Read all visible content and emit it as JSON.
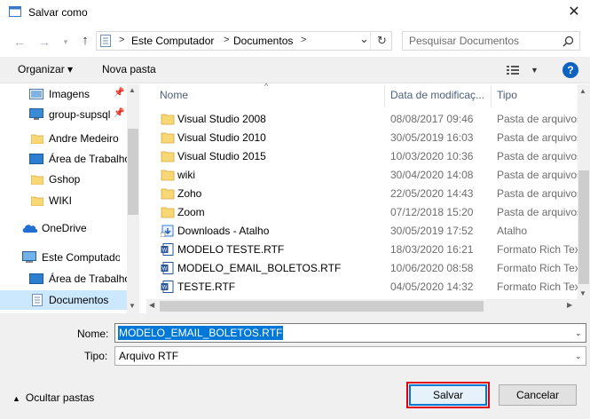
{
  "window": {
    "title": "Salvar como",
    "close_glyph": "✕"
  },
  "nav": {
    "back_icon": "arrow-left-icon",
    "forward_icon": "arrow-right-icon",
    "recent_icon": "chevron-down-icon",
    "up_icon": "arrow-up-icon"
  },
  "address": {
    "sep": ">",
    "crumbs": [
      "Este Computador",
      "Documentos"
    ],
    "dropdown_glyph": "⌄",
    "refresh_glyph": "↻"
  },
  "search": {
    "placeholder": "Pesquisar Documentos",
    "icon": "search-icon"
  },
  "toolbar": {
    "organize": "Organizar ▾",
    "new_folder": "Nova pasta",
    "help": "?"
  },
  "sidebar": {
    "items": [
      {
        "label": "Imagens",
        "icon": "images-icon",
        "pinned": true
      },
      {
        "label": "group-supsql",
        "icon": "monitor-icon",
        "pinned": true
      },
      {
        "label": "Andre Medeiro",
        "icon": "folder-icon",
        "pinned": false
      },
      {
        "label": "Área de Trabalho",
        "icon": "desktop-icon",
        "pinned": false
      },
      {
        "label": "Gshop",
        "icon": "folder-icon",
        "pinned": false
      },
      {
        "label": "WIKI",
        "icon": "folder-icon",
        "pinned": false
      },
      {
        "label": "OneDrive",
        "icon": "cloud-icon",
        "pinned": false
      },
      {
        "label": "Este Computador",
        "icon": "computer-icon",
        "pinned": false
      },
      {
        "label": "Área de Trabalho",
        "icon": "desktop-icon",
        "pinned": false
      },
      {
        "label": "Documentos",
        "icon": "documents-icon",
        "pinned": false,
        "selected": true
      }
    ]
  },
  "columns": {
    "name": "Nome",
    "date": "Data de modificaç...",
    "type": "Tipo"
  },
  "files": [
    {
      "name": "Visual Studio 2008",
      "date": "08/08/2017 09:46",
      "type": "Pasta de arquivos",
      "icon": "folder-icon"
    },
    {
      "name": "Visual Studio 2010",
      "date": "30/05/2019 16:03",
      "type": "Pasta de arquivos",
      "icon": "folder-icon"
    },
    {
      "name": "Visual Studio 2015",
      "date": "10/03/2020 10:36",
      "type": "Pasta de arquivos",
      "icon": "folder-icon"
    },
    {
      "name": "wiki",
      "date": "30/04/2020 14:08",
      "type": "Pasta de arquivos",
      "icon": "folder-icon"
    },
    {
      "name": "Zoho",
      "date": "22/05/2020 14:43",
      "type": "Pasta de arquivos",
      "icon": "folder-icon"
    },
    {
      "name": "Zoom",
      "date": "07/12/2018 15:20",
      "type": "Pasta de arquivos",
      "icon": "folder-icon"
    },
    {
      "name": "Downloads - Atalho",
      "date": "30/05/2019 17:52",
      "type": "Atalho",
      "icon": "shortcut-icon"
    },
    {
      "name": "MODELO TESTE.RTF",
      "date": "18/03/2020 16:21",
      "type": "Formato Rich Text",
      "icon": "rtf-file-icon"
    },
    {
      "name": "MODELO_EMAIL_BOLETOS.RTF",
      "date": "10/06/2020 08:58",
      "type": "Formato Rich Text",
      "icon": "rtf-file-icon"
    },
    {
      "name": "TESTE.RTF",
      "date": "04/05/2020 14:32",
      "type": "Formato Rich Text",
      "icon": "rtf-file-icon"
    }
  ],
  "form": {
    "name_label": "Nome:",
    "name_value": "MODELO_EMAIL_BOLETOS.RTF",
    "type_label": "Tipo:",
    "type_value": "Arquivo RTF"
  },
  "footer": {
    "hide_folders": "Ocultar pastas",
    "save": "Salvar",
    "cancel": "Cancelar"
  },
  "colors": {
    "accent": "#0078d7",
    "highlight_outline": "#e00010",
    "selection": "#cce8ff",
    "folder": "#f8d775"
  }
}
